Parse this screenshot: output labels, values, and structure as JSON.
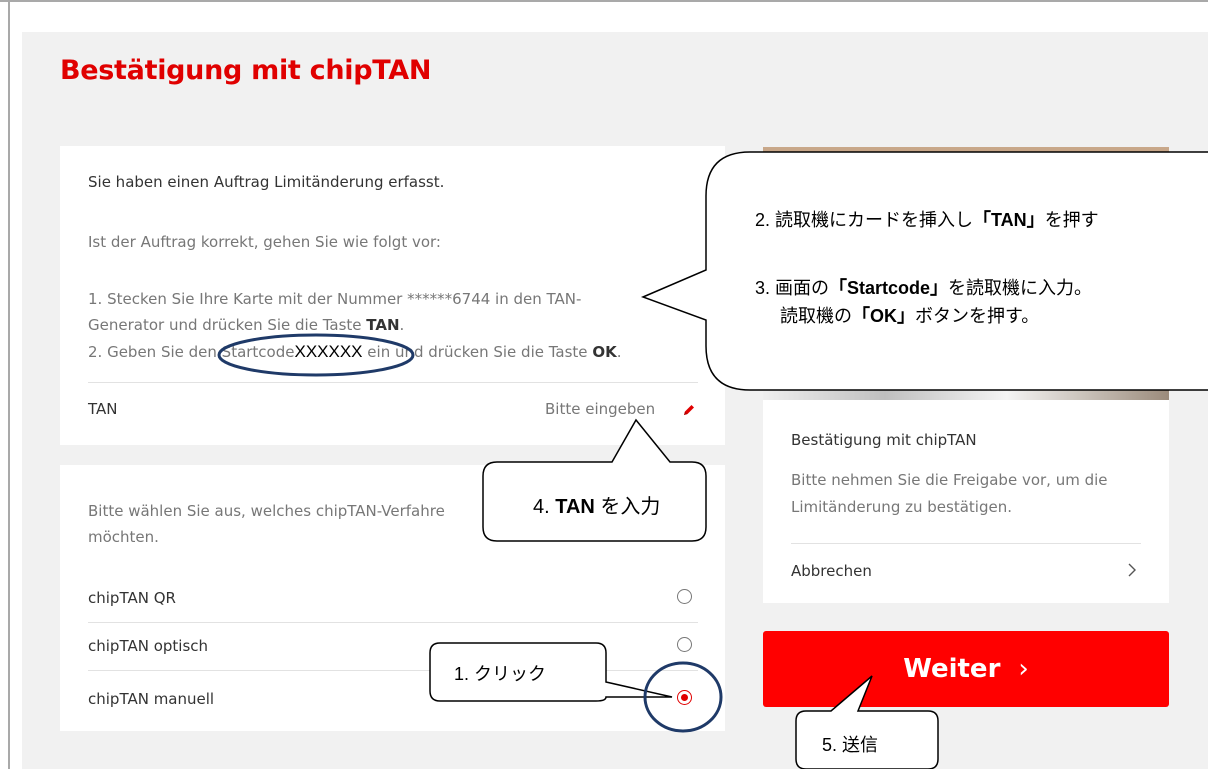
{
  "page_title": "Bestätigung mit chipTAN",
  "order_card": {
    "intro": "Sie haben einen Auftrag Limitänderung erfasst.",
    "instruction_lead": "Ist der Auftrag korrekt, gehen Sie wie folgt vor:",
    "step1_line1_pre": "1. Stecken Sie Ihre Karte mit der Nummer ******6744 in den TAN-",
    "step1_line2_pre": "Generator und drücken Sie die Taste ",
    "step1_key": "TAN",
    "step2_pre": "2. Geben Sie den Startcode",
    "step2_code": "XXXXXX",
    "step2_post": " ein und drücken Sie die Taste ",
    "step2_key": "OK",
    "tan_label": "TAN",
    "tan_placeholder": "Bitte eingeben"
  },
  "method_card": {
    "prompt_line1": "Bitte wählen Sie aus, welches chipTAN-Verfahre",
    "prompt_line2": "möchten.",
    "options": [
      {
        "label": "chipTAN QR",
        "selected": false
      },
      {
        "label": "chipTAN optisch",
        "selected": false
      },
      {
        "label": "chipTAN manuell",
        "selected": true
      }
    ]
  },
  "side_card": {
    "title": "Bestätigung mit chipTAN",
    "text_line1": "Bitte nehmen Sie die Freigabe vor, um die",
    "text_line2": "Limitänderung zu bestätigen.",
    "cancel_label": "Abbrechen"
  },
  "weiter_button": {
    "label": "Weiter",
    "chevron": "›"
  },
  "annotations": {
    "callout_steps_2_3": {
      "line1_pre": "2. 読取機にカードを挿入し",
      "line1_bold": "「TAN」",
      "line1_post": "を押す",
      "line2_pre": "3. 画面の",
      "line2_bold": "「Startcode」",
      "line2_post": "を読取機に入力。",
      "line3_pre": "読取機の",
      "line3_bold": "「OK」",
      "line3_post": "ボタンを押す。"
    },
    "callout_tan": {
      "prefix": "4. ",
      "bold": "TAN",
      "suffix": " を入力"
    },
    "callout_click": "1. クリック",
    "callout_send": "5. 送信"
  },
  "colors": {
    "accent_red": "#e00000",
    "button_red": "#ff0000",
    "annotation_oval": "#1f3a68"
  }
}
